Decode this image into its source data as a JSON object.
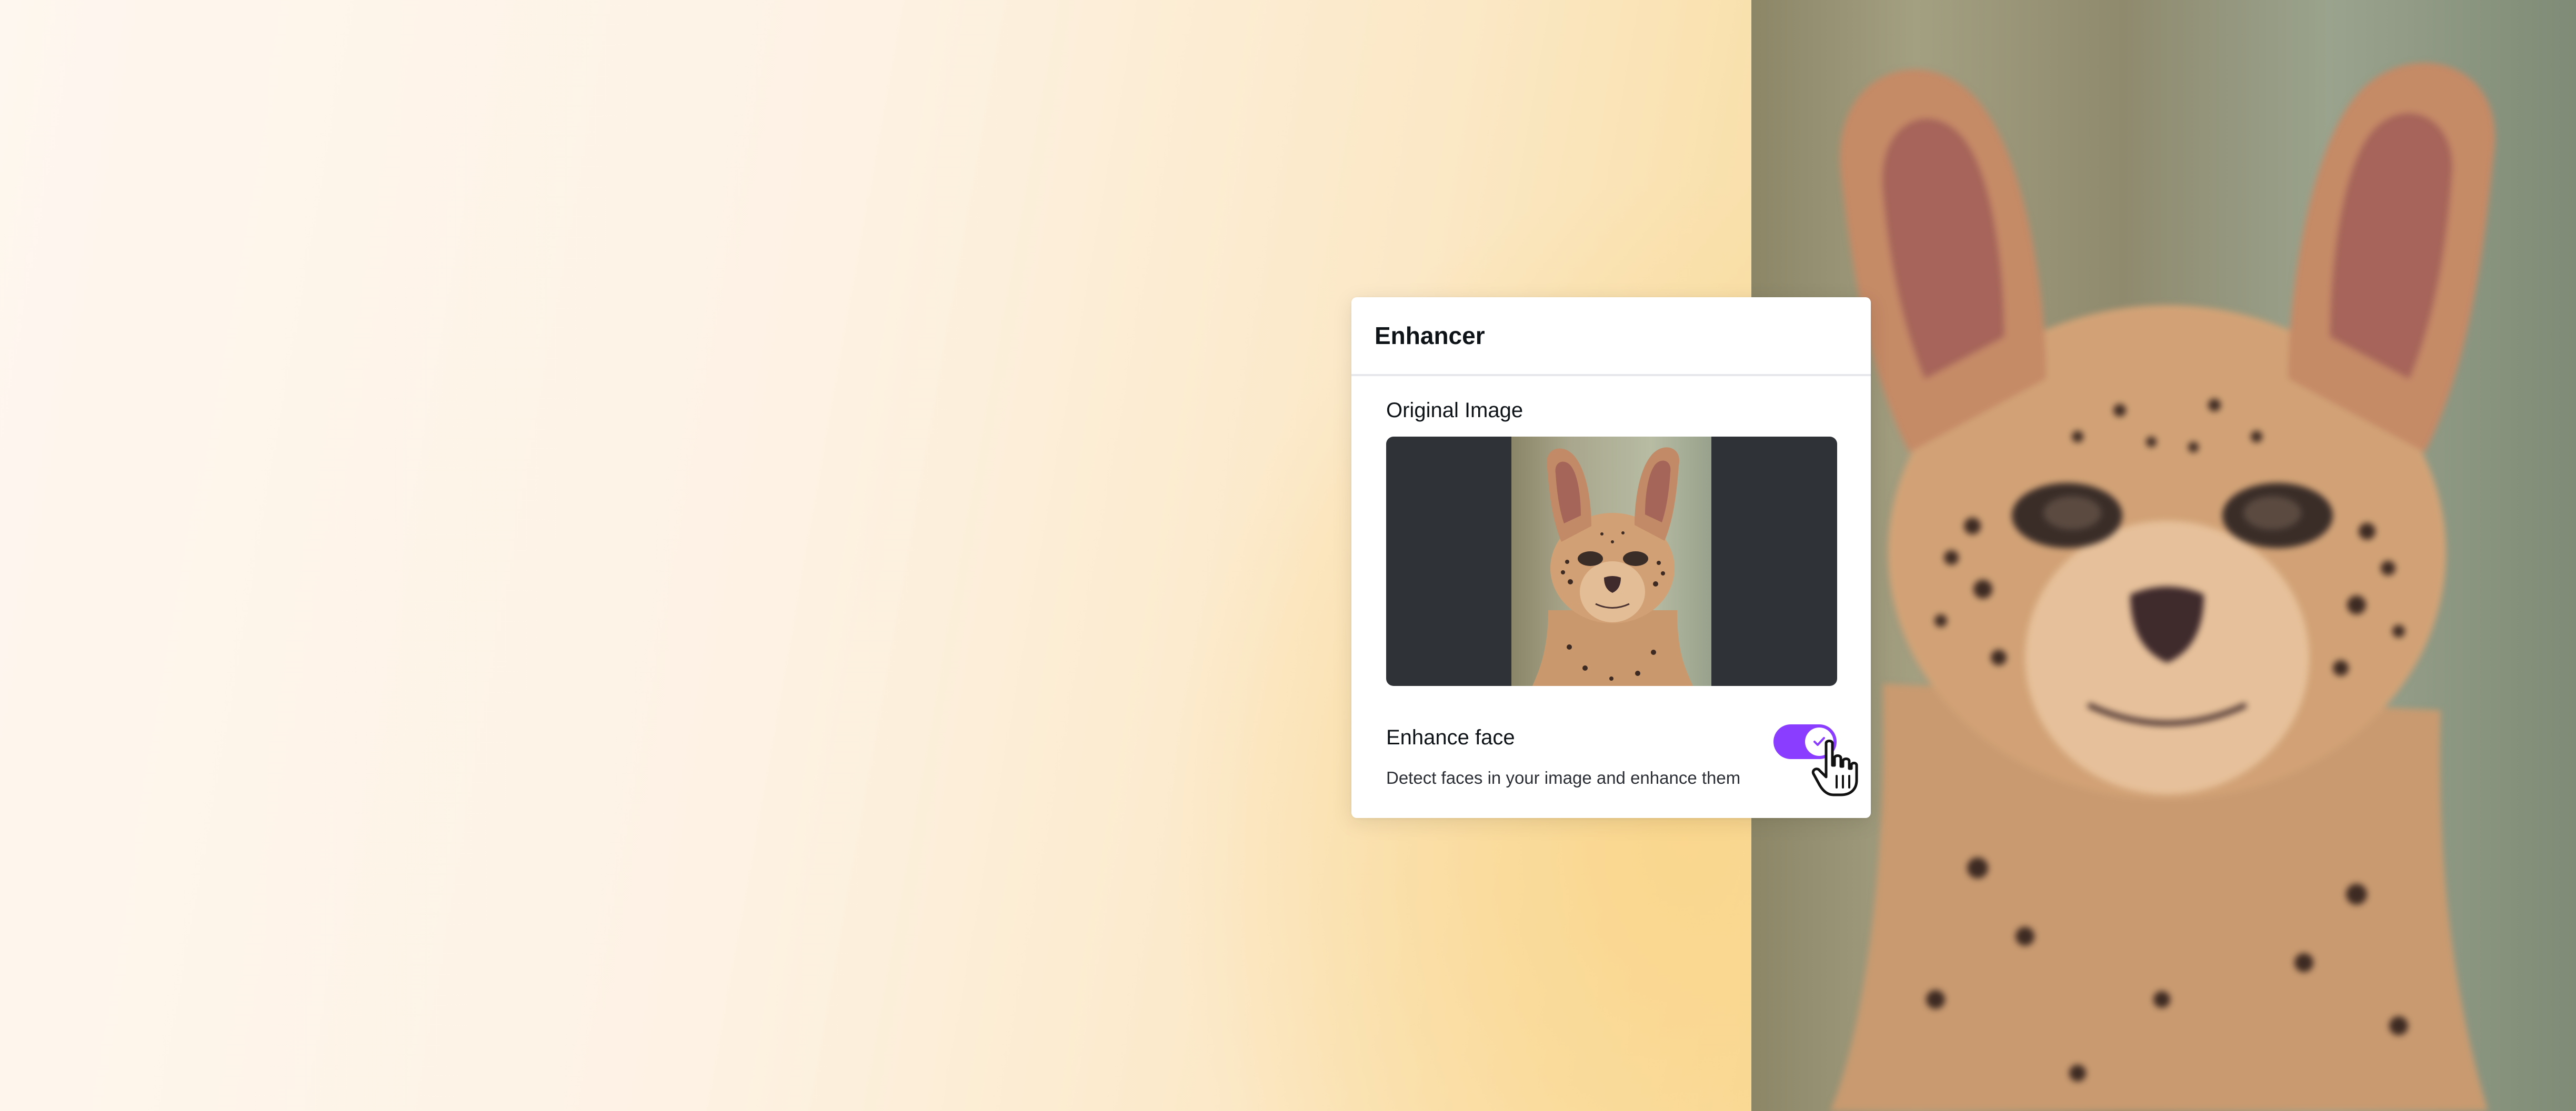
{
  "panel": {
    "title": "Enhancer",
    "original_image_label": "Original Image",
    "enhance_face": {
      "label": "Enhance face",
      "description": "Detect faces in your image and enhance them",
      "enabled": true
    }
  },
  "icons": {
    "toggle_check": "check-icon",
    "cursor": "hand-pointer-icon"
  },
  "colors": {
    "accent": "#8b3dff",
    "preview_bg": "#2f3237"
  }
}
